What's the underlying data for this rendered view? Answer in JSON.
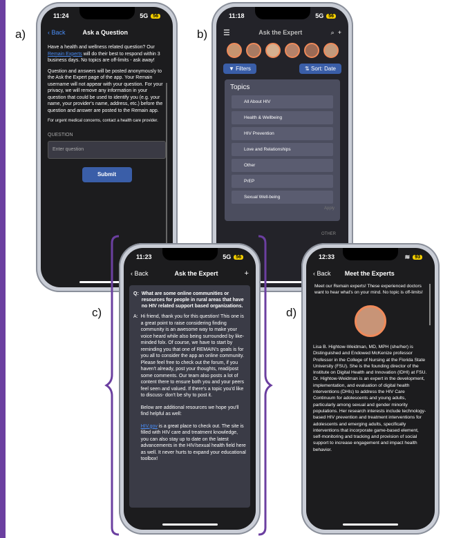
{
  "labels": {
    "a": "a)",
    "b": "b)",
    "c": "c)",
    "d": "d)"
  },
  "phone_a": {
    "time": "11:24",
    "signal": "5G",
    "battery": "56",
    "back": "Back",
    "title": "Ask a Question",
    "intro_pre": "Have a health and wellness related question? Our ",
    "intro_link": "Remain Experts",
    "intro_post": " will do their best to respond within 3 business days. No topics are off-limits - ask away!",
    "privacy": "Question and answers will be posted anonymously to the Ask the Expert page of the app. Your Remain username will not appear with your question. For your privacy, we will remove any information in your question that could be used to identify you (e.g. your name, your provider's name, address, etc.) before the question and answer are posted to the Remain app.",
    "urgent": "For urgent medical concerns, contact a health care provider.",
    "question_label": "QUESTION",
    "question_placeholder": "Enter question",
    "submit": "Submit"
  },
  "phone_b": {
    "time": "11:18",
    "signal": "5G",
    "battery": "56",
    "title": "Ask the Expert",
    "filters": "Filters",
    "sort": "Sort: Date",
    "topics_title": "Topics",
    "topics": [
      "All About HIV",
      "Health & Wellbeing",
      "HIV Prevention",
      "Love and Relationships",
      "Other",
      "PrEP",
      "Sexual Well-being"
    ],
    "apply": "Apply",
    "other_tag": "OTHER"
  },
  "phone_c": {
    "time": "11:23",
    "signal": "5G",
    "battery": "56",
    "back": "Back",
    "title": "Ask the Expert",
    "q_prefix": "Q:",
    "question": "What are some online communities or resources for people in rural areas that have no HIV related support based organizations.",
    "a_prefix": "A:",
    "answer": "Hi friend, thank you for this question! This one is a great point to raise considering finding community is an awesome way to make your voice heard while also being surrounded by like- minded folx. Of course, we have to start by reminding you that one of REMAIN's goals is for you all to consider the app an online community. Please feel free to check out the forum, if you haven't already, post your thoughts, read/post some comments. Our team also posts a lot of content there to ensure both you and your peers feel seen and valued. If there's a topic you'd like to discuss- don't be shy to post it.",
    "resources_intro": "Below are additional resources we hope you'll find helpful as well:",
    "res_link": "HIV.gov",
    "res_text": " is a great place to check out. The site is filled with HIV care and treatment knowledge, you can also stay up to date on the latest advancements in the HIV/sexual health field here as well. It never hurts to expand your educational toolbox!"
  },
  "phone_d": {
    "time": "12:33",
    "battery": "93",
    "back": "Back",
    "title": "Meet the Experts",
    "intro": "Meet our Remain experts! These experienced doctors want to hear what's on your mind. No topic is off-limits!",
    "bio": "Lisa B. Hightow-Weidman, MD, MPH (she/her) is Distinguished and Endowed McKenize professor Professor in the College of Nursing at the Florida State University (FSU). She is the founding director of the Institute on Digital Health and Innovation (IDHI) at FSU. Dr. Hightow-Weidman is an expert in the development, implementation, and evaluation of digital health interventions (DHIs) to address the HIV Care Continuum for adolescents and young adults, particularly among sexual and gender minority populations. Her research interests include technology-based HIV prevention and treatment interventions for adolescents and emerging adults, specifically interventions that incorporate game-based element, self-monitoring and tracking and provision of social support to increase engagement and impact health behavior."
  },
  "colors": {
    "accent": "#6b3fa0",
    "link": "#4a8df6",
    "button": "#3a5ea8"
  }
}
